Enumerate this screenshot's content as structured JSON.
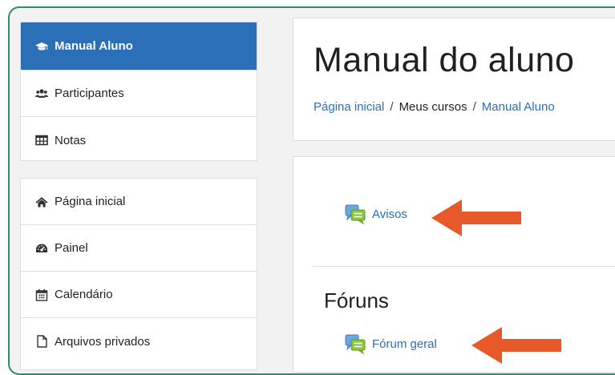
{
  "course_nav": {
    "items": [
      {
        "label": "Manual Aluno",
        "icon": "graduation-cap-icon",
        "active": true
      },
      {
        "label": "Participantes",
        "icon": "users-icon"
      },
      {
        "label": "Notas",
        "icon": "table-icon"
      }
    ]
  },
  "site_nav": {
    "items": [
      {
        "label": "Página inicial",
        "icon": "home-icon"
      },
      {
        "label": "Painel",
        "icon": "dashboard-icon"
      },
      {
        "label": "Calendário",
        "icon": "calendar-icon"
      },
      {
        "label": "Arquivos privados",
        "icon": "file-icon"
      }
    ]
  },
  "header": {
    "title": "Manual do aluno",
    "breadcrumb": [
      "Página inicial",
      "Meus cursos",
      "Manual Aluno"
    ]
  },
  "content": {
    "announcements_link": "Avisos",
    "forums_section_title": "Fóruns",
    "general_forum_link": "Fórum geral"
  },
  "colors": {
    "accent": "#2a6fb8",
    "frame_border": "#2e8b6e",
    "arrow": "#e8592a"
  }
}
